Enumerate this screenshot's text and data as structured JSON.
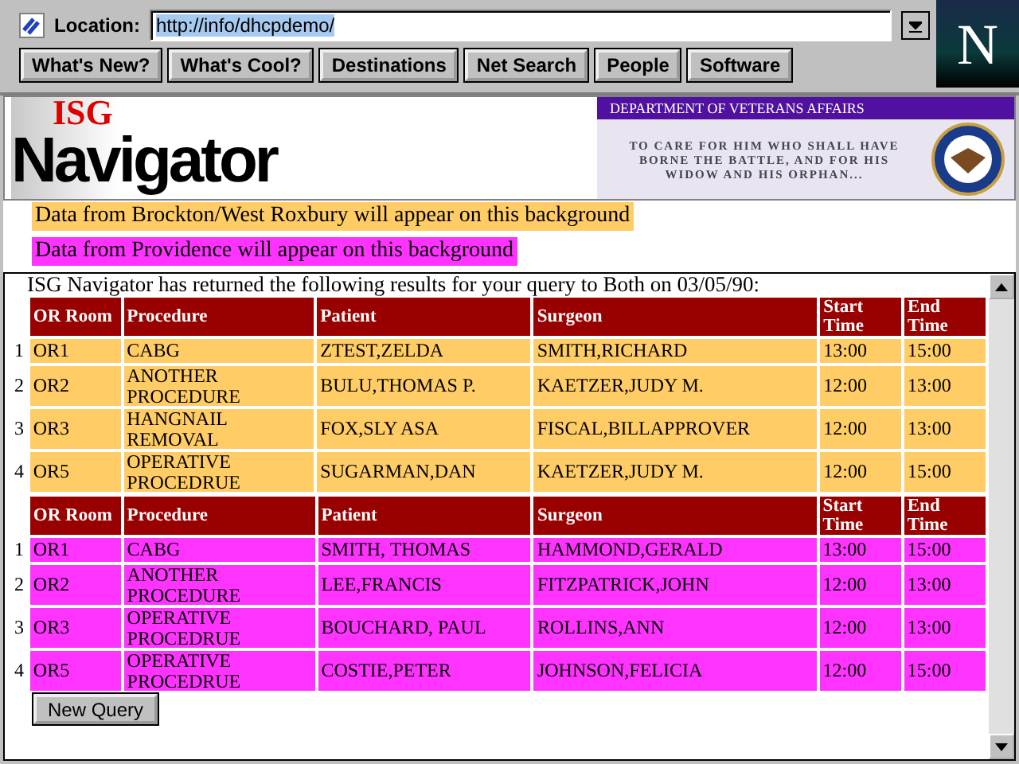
{
  "toolbar": {
    "location_label": "Location:",
    "url": "http://info/dhcpdemo/",
    "buttons": [
      "What's New?",
      "What's Cool?",
      "Destinations",
      "Net Search",
      "People",
      "Software"
    ],
    "logo_letter": "N"
  },
  "banner": {
    "logo_top": "ISG",
    "logo_main": "Navigator",
    "va_header": "DEPARTMENT OF VETERANS AFFAIRS",
    "va_motto": "TO CARE FOR HIM WHO SHALL HAVE BORNE THE BATTLE, AND FOR HIS WIDOW AND HIS ORPHAN..."
  },
  "legend": [
    {
      "text": "Data from Brockton/West Roxbury will appear on this background",
      "color": "#ffcc66"
    },
    {
      "text": "Data from Providence will appear on this background",
      "color": "#ff33ff"
    }
  ],
  "results": {
    "intro": "ISG Navigator has returned the following results for your query to Both on 03/05/90:",
    "tables": [
      {
        "color": "#ffcc66",
        "columns": [
          "OR Room",
          "Procedure",
          "Patient",
          "Surgeon",
          "Start Time",
          "End Time"
        ],
        "rows": [
          {
            "index": "1",
            "cells": [
              "OR1",
              "CABG",
              "ZTEST,ZELDA",
              "SMITH,RICHARD",
              "13:00",
              "15:00"
            ]
          },
          {
            "index": "2",
            "cells": [
              "OR2",
              "ANOTHER PROCEDURE",
              "BULU,THOMAS P.",
              "KAETZER,JUDY M.",
              "12:00",
              "13:00"
            ]
          },
          {
            "index": "3",
            "cells": [
              "OR3",
              "HANGNAIL REMOVAL",
              "FOX,SLY ASA",
              "FISCAL,BILLAPPROVER",
              "12:00",
              "13:00"
            ]
          },
          {
            "index": "4",
            "cells": [
              "OR5",
              "OPERATIVE PROCEDRUE",
              "SUGARMAN,DAN",
              "KAETZER,JUDY M.",
              "12:00",
              "15:00"
            ]
          }
        ]
      },
      {
        "color": "#ff33ff",
        "columns": [
          "OR Room",
          "Procedure",
          "Patient",
          "Surgeon",
          "Start Time",
          "End Time"
        ],
        "rows": [
          {
            "index": "1",
            "cells": [
              "OR1",
              "CABG",
              "SMITH, THOMAS",
              "HAMMOND,GERALD",
              "13:00",
              "15:00"
            ]
          },
          {
            "index": "2",
            "cells": [
              "OR2",
              "ANOTHER PROCEDURE",
              "LEE,FRANCIS",
              "FITZPATRICK,JOHN",
              "12:00",
              "13:00"
            ]
          },
          {
            "index": "3",
            "cells": [
              "OR3",
              "OPERATIVE PROCEDRUE",
              "BOUCHARD, PAUL",
              "ROLLINS,ANN",
              "12:00",
              "13:00"
            ]
          },
          {
            "index": "4",
            "cells": [
              "OR5",
              "OPERATIVE PROCEDRUE",
              "COSTIE,PETER",
              "JOHNSON,FELICIA",
              "12:00",
              "15:00"
            ]
          }
        ]
      }
    ],
    "button": "New Query"
  }
}
